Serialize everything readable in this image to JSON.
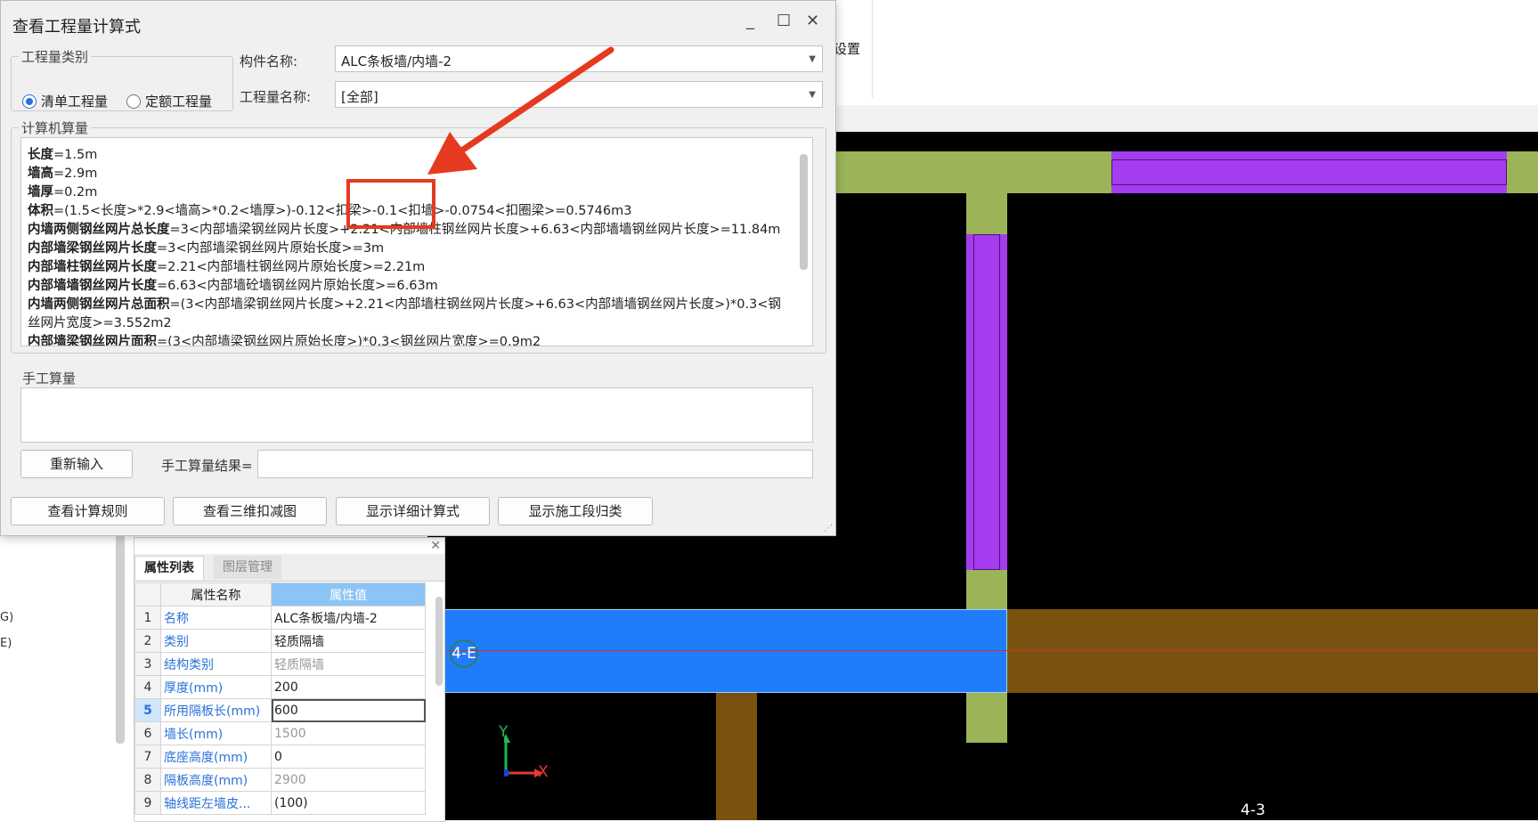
{
  "background_app": {
    "settings_label": "设置",
    "left_labels": [
      "G)",
      "E)"
    ]
  },
  "canvas": {
    "axis_label_1": "4-E",
    "axis_label_2": "4-3",
    "axis_x": "X",
    "axis_y": "Y",
    "colors": {
      "green": "#9bb458",
      "purple": "#a53cf0",
      "blue": "#1f7dfb",
      "brown": "#7a5210",
      "red_line": "#d32f2f"
    }
  },
  "properties": {
    "tabs": [
      "属性列表",
      "图层管理"
    ],
    "headers": {
      "name": "属性名称",
      "value": "属性值"
    },
    "rows": [
      {
        "no": "1",
        "name": "名称",
        "value": "ALC条板墙/内墙-2",
        "style": "normal"
      },
      {
        "no": "2",
        "name": "类别",
        "value": "轻质隔墙",
        "style": "normal"
      },
      {
        "no": "3",
        "name": "结构类别",
        "value": "轻质隔墙",
        "style": "grey"
      },
      {
        "no": "4",
        "name": "厚度(mm)",
        "value": "200",
        "style": "normal"
      },
      {
        "no": "5",
        "name": "所用隔板长(mm)",
        "value": "600",
        "style": "edit"
      },
      {
        "no": "6",
        "name": "墙长(mm)",
        "value": "1500",
        "style": "grey"
      },
      {
        "no": "7",
        "name": "底座高度(mm)",
        "value": "0",
        "style": "normal"
      },
      {
        "no": "8",
        "name": "隔板高度(mm)",
        "value": "2900",
        "style": "grey"
      },
      {
        "no": "9",
        "name": "轴线距左墙皮...",
        "value": "(100)",
        "style": "normal"
      }
    ]
  },
  "dialog": {
    "title": "查看工程量计算式",
    "window_controls": {
      "minimize": "_",
      "maximize": "☐",
      "close": "✕"
    },
    "quantity_type": {
      "legend": "工程量类别",
      "options": [
        "清单工程量",
        "定额工程量"
      ],
      "selected": "清单工程量"
    },
    "component_label": "构件名称:",
    "component_value": "ALC条板墙/内墙-2",
    "quantity_name_label": "工程量名称:",
    "quantity_name_value": "[全部]",
    "computer_calc": {
      "legend": "计算机算量",
      "lines": [
        {
          "key": "长度",
          "rest": "=1.5m"
        },
        {
          "key": "墙高",
          "rest": "=2.9m"
        },
        {
          "key": "墙厚",
          "rest": "=0.2m"
        },
        {
          "key": "体积",
          "rest": "=(1.5<长度>*2.9<墙高>*0.2<墙厚>)-0.12<扣梁>-0.1<扣墙>-0.0754<扣圈梁>=0.5746m3"
        },
        {
          "key": "内墙两侧钢丝网片总长度",
          "rest": "=3<内部墙梁钢丝网片长度>+2.21<内部墙柱钢丝网片长度>+6.63<内部墙墙钢丝网片长度>=11.84m"
        },
        {
          "key": "内部墙梁钢丝网片长度",
          "rest": "=3<内部墙梁钢丝网片原始长度>=3m"
        },
        {
          "key": "内部墙柱钢丝网片长度",
          "rest": "=2.21<内部墙柱钢丝网片原始长度>=2.21m"
        },
        {
          "key": "内部墙墙钢丝网片长度",
          "rest": "=6.63<内部墙砼墙钢丝网片原始长度>=6.63m"
        },
        {
          "key": "内墙两侧钢丝网片总面积",
          "rest": "=(3<内部墙梁钢丝网片长度>+2.21<内部墙柱钢丝网片长度>+6.63<内部墙墙钢丝网片长度>)*0.3<钢"
        },
        {
          "key": "",
          "rest": "丝网片宽度>=3.552m2"
        },
        {
          "key": "内部墙梁钢丝网片面积",
          "rest": "=(3<内部墙梁钢丝网片原始长度>)*0.3<钢丝网片宽度>=0.9m2"
        }
      ]
    },
    "manual_calc": {
      "legend": "手工算量",
      "reenter_button": "重新输入",
      "result_label": "手工算量结果="
    },
    "buttons": {
      "rules": "查看计算规则",
      "deduction_3d": "查看三维扣减图",
      "detail": "显示详细计算式",
      "stage": "显示施工段归类"
    }
  }
}
